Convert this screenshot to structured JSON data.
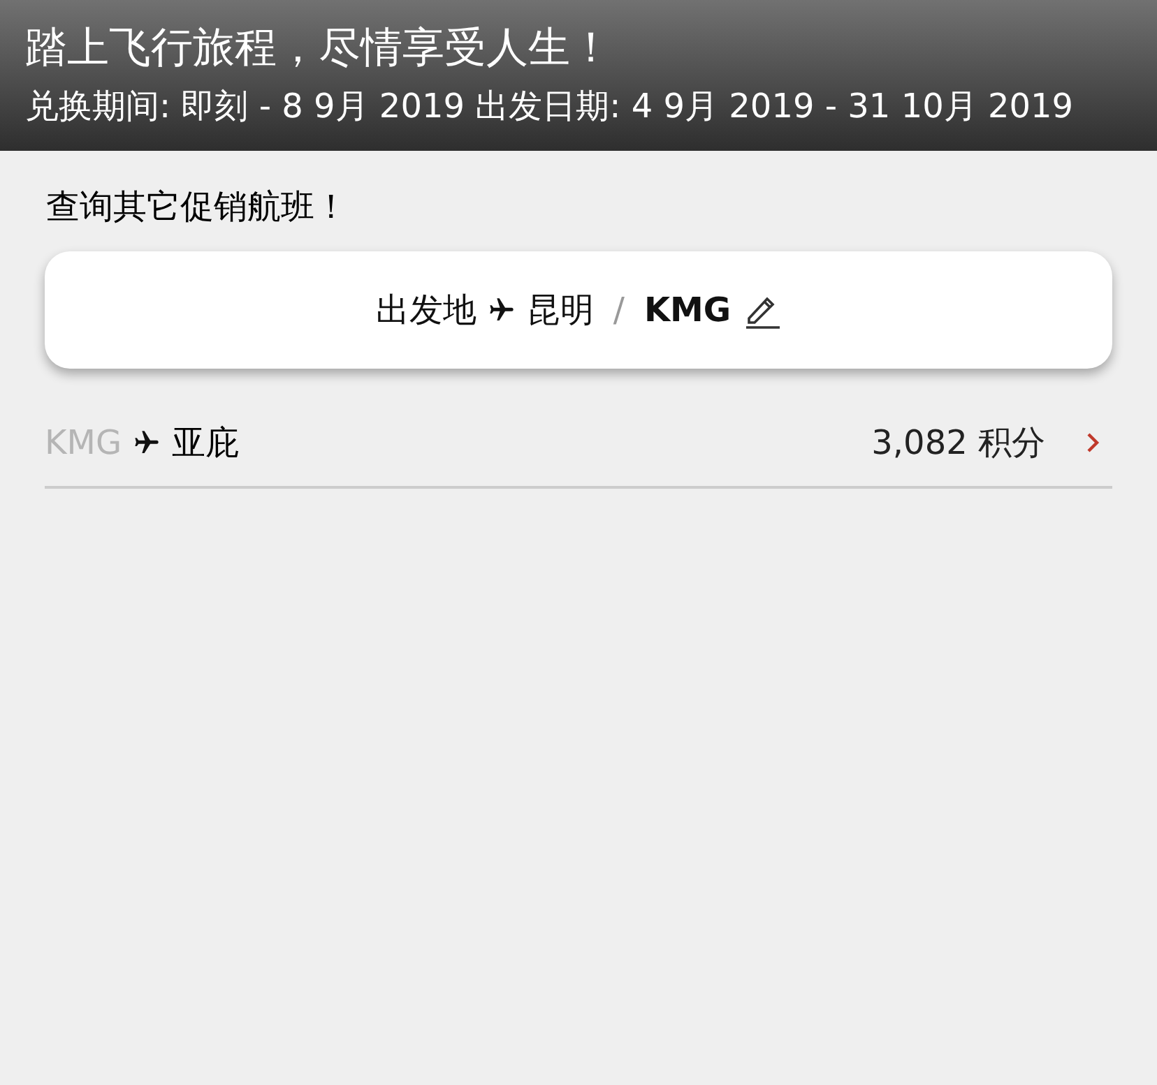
{
  "header": {
    "title": "踏上飞行旅程，尽情享受人生！",
    "subtitle": "兑换期间: 即刻 - 8 9月 2019 出发日期: 4 9月 2019 - 31 10月 2019"
  },
  "prompt": "查询其它促销航班！",
  "origin": {
    "label": "出发地",
    "city": "昆明",
    "separator": "/",
    "code": "KMG"
  },
  "routes": [
    {
      "from": "KMG",
      "to": "亚庇",
      "points": "3,082 积分"
    }
  ]
}
